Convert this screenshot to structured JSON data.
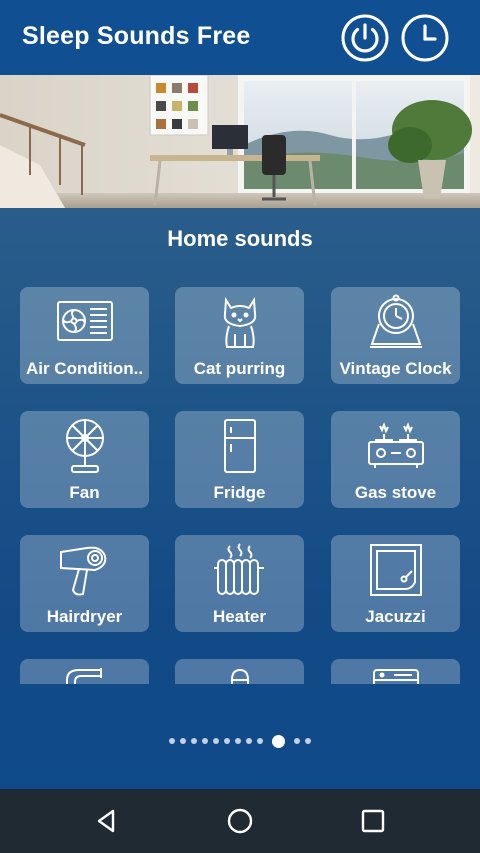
{
  "app": {
    "title": "Sleep Sounds Free",
    "power_icon": "power-icon",
    "timer_icon": "clock-icon"
  },
  "hero": {
    "description_icon": "room-illustration"
  },
  "section": {
    "title": "Home sounds"
  },
  "tiles": [
    {
      "label": "Air Condition..",
      "icon": "air-conditioner-icon"
    },
    {
      "label": "Cat purring",
      "icon": "cat-icon"
    },
    {
      "label": "Vintage Clock",
      "icon": "vintage-clock-icon"
    },
    {
      "label": "Fan",
      "icon": "fan-icon"
    },
    {
      "label": "Fridge",
      "icon": "fridge-icon"
    },
    {
      "label": "Gas stove",
      "icon": "gas-stove-icon"
    },
    {
      "label": "Hairdryer",
      "icon": "hairdryer-icon"
    },
    {
      "label": "Heater",
      "icon": "heater-icon"
    },
    {
      "label": "Jacuzzi",
      "icon": "jacuzzi-icon"
    },
    {
      "label": "",
      "icon": "faucet-icon"
    },
    {
      "label": "",
      "icon": "shower-icon"
    },
    {
      "label": "",
      "icon": "washing-machine-icon"
    }
  ],
  "pager": {
    "total": 12,
    "active_index": 9
  },
  "navbar": {
    "back_icon": "back-icon",
    "home_icon": "home-icon",
    "recents_icon": "recents-icon"
  },
  "colors": {
    "appbar": "#0f4f92",
    "tile": "rgba(255,255,255,0.26)",
    "navbar": "#1f2a33"
  }
}
